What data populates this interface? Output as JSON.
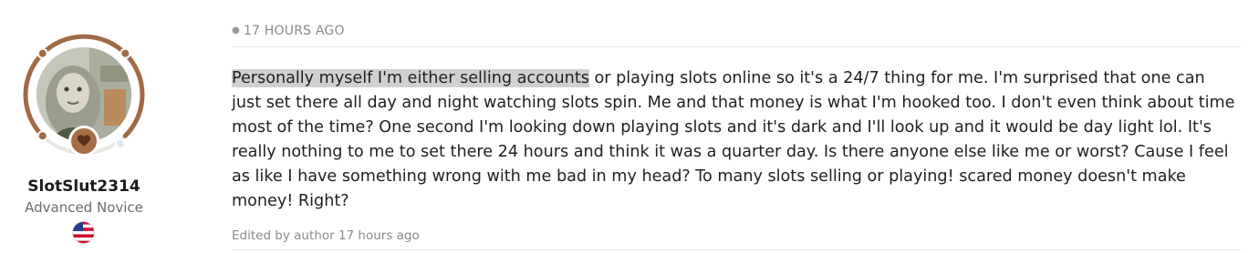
{
  "author": {
    "username": "SlotSlut2314",
    "rank": "Advanced Novice",
    "flag_icon": "us-flag-icon",
    "rank_badge_color": "#a66d47",
    "ring_color": "#a06a44"
  },
  "post": {
    "timestamp": "17 HOURS AGO",
    "highlighted_text": "Personally myself I'm either selling accounts",
    "body_text": " or playing slots online so it's a 24/7 thing for me. I'm surprised that one can just set there all day and night watching slots spin. Me and that money is what I'm hooked too. I don't even think about time most of the time? One second I'm looking down playing slots and it's dark and I'll look up and it would be day light lol. It's really nothing to me to set there 24 hours and think it was a quarter day. Is there anyone else like me or worst? Cause I feel as like I have something wrong with me bad in my head? To many slots selling or playing! scared money doesn't make money! Right?",
    "edited_note": "Edited by author 17 hours ago"
  }
}
